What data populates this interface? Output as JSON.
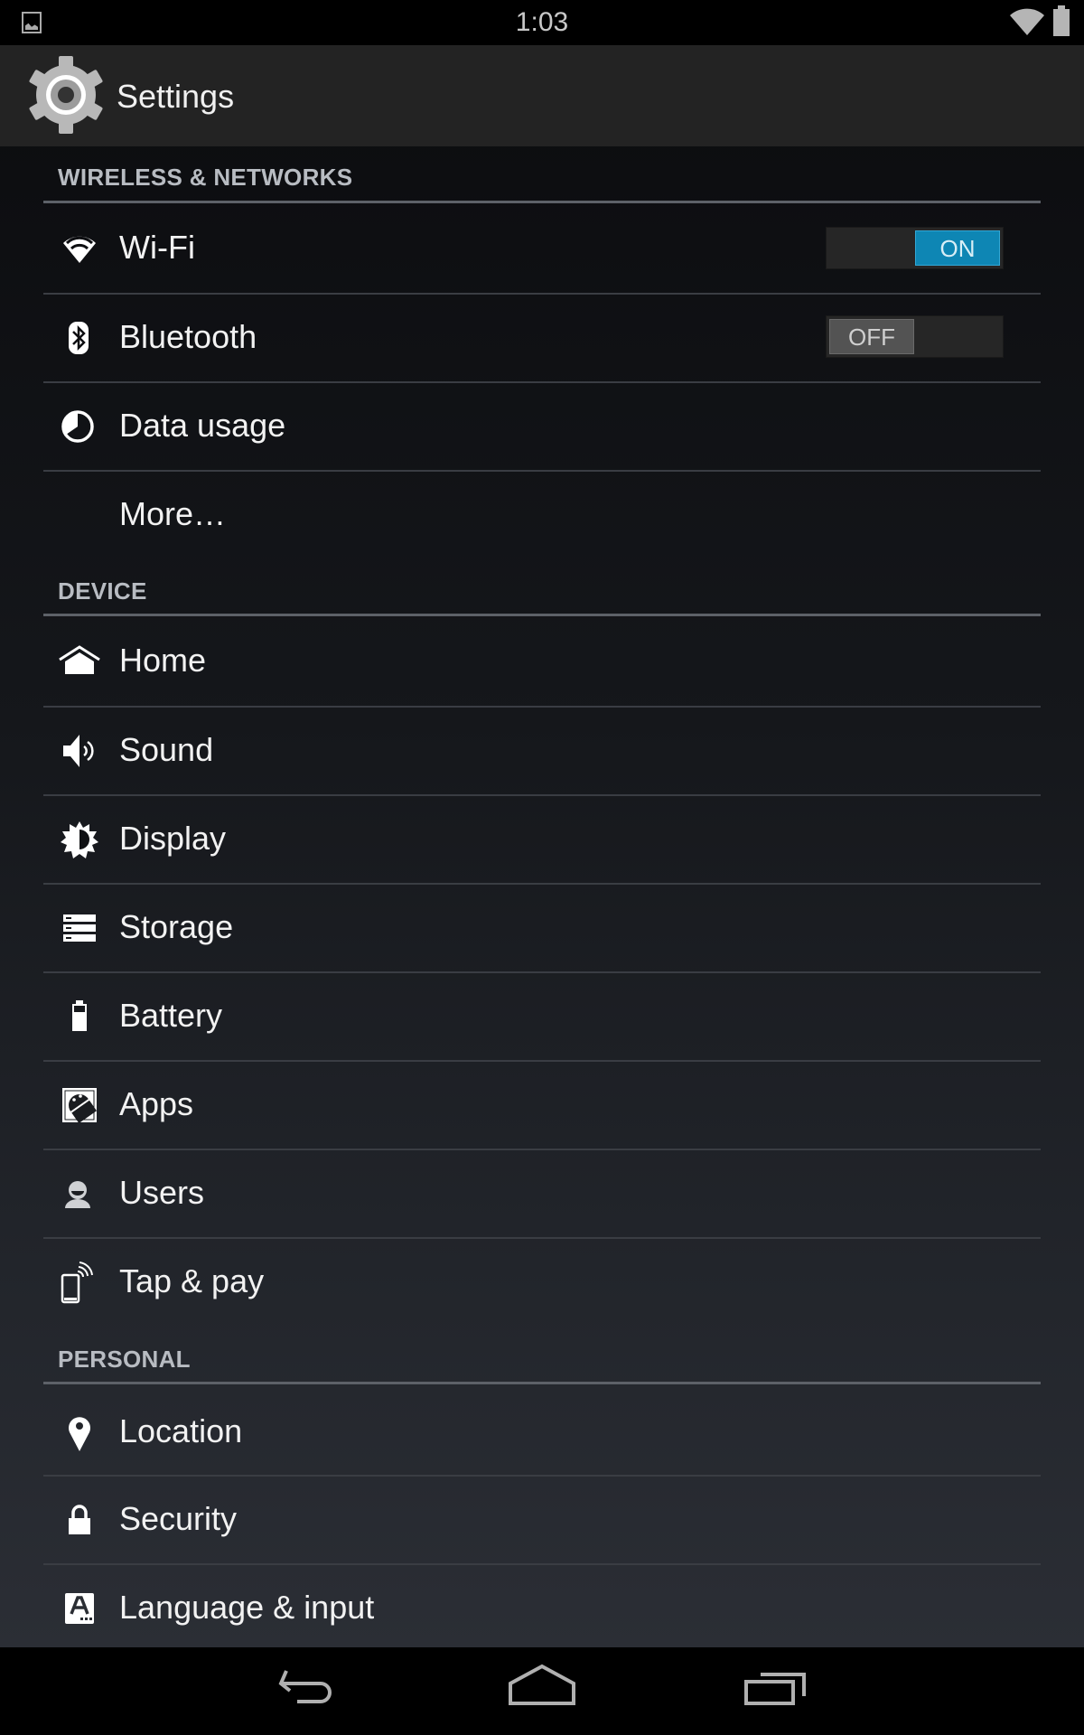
{
  "status_bar": {
    "time": "1:03",
    "icons": [
      "gallery-notification-icon",
      "wifi-signal-icon",
      "battery-icon"
    ]
  },
  "action_bar": {
    "title": "Settings",
    "icon": "settings-gear-icon"
  },
  "sections": [
    {
      "header": "WIRELESS & NETWORKS",
      "items": [
        {
          "label": "Wi-Fi",
          "icon": "wifi-icon",
          "toggle": {
            "state": "on",
            "label": "ON"
          }
        },
        {
          "label": "Bluetooth",
          "icon": "bluetooth-icon",
          "toggle": {
            "state": "off",
            "label": "OFF"
          }
        },
        {
          "label": "Data usage",
          "icon": "data-usage-icon"
        },
        {
          "label": "More…",
          "icon": null
        }
      ]
    },
    {
      "header": "DEVICE",
      "items": [
        {
          "label": "Home",
          "icon": "home-icon"
        },
        {
          "label": "Sound",
          "icon": "speaker-icon"
        },
        {
          "label": "Display",
          "icon": "brightness-icon"
        },
        {
          "label": "Storage",
          "icon": "storage-icon"
        },
        {
          "label": "Battery",
          "icon": "battery-icon"
        },
        {
          "label": "Apps",
          "icon": "apps-android-icon"
        },
        {
          "label": "Users",
          "icon": "user-icon"
        },
        {
          "label": "Tap & pay",
          "icon": "nfc-phone-icon"
        }
      ]
    },
    {
      "header": "PERSONAL",
      "items": [
        {
          "label": "Location",
          "icon": "location-pin-icon"
        },
        {
          "label": "Security",
          "icon": "lock-icon"
        },
        {
          "label": "Language & input",
          "icon": "keyboard-language-icon"
        }
      ]
    }
  ],
  "nav_bar": {
    "buttons": [
      "back",
      "home",
      "recent-apps"
    ]
  },
  "colors": {
    "toggle_on": "#0e86b4",
    "toggle_off": "#535353",
    "action_bar": "#232323"
  }
}
